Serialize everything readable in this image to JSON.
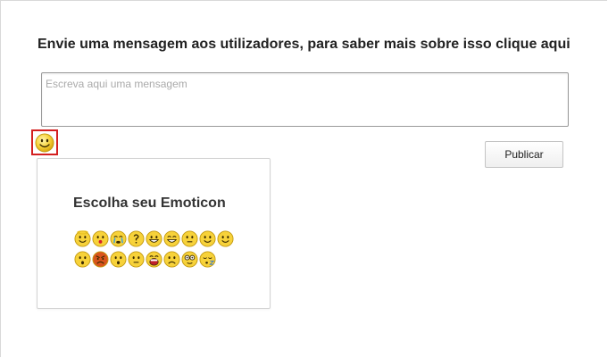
{
  "heading": "Envie uma mensagem aos utilizadores, para saber mais sobre isso clique aqui",
  "message": {
    "placeholder": "Escreva aqui uma mensagem",
    "value": ""
  },
  "emoticon_button": {
    "icon": "smiley-icon"
  },
  "publish_label": "Publicar",
  "emoticon_panel": {
    "title": "Escolha seu Emoticon",
    "rows": [
      [
        "angel",
        "kiss",
        "crying",
        "confused",
        "grin",
        "laugh",
        "neutral",
        "smile",
        "smile"
      ],
      [
        "surprised",
        "angry",
        "surprised",
        "neutral",
        "big-laugh",
        "sad",
        "glasses",
        "sleepy"
      ]
    ]
  },
  "colors": {
    "smiley_fill": "#f7d23a",
    "smiley_stroke": "#c49b12",
    "highlight": "#d42020"
  }
}
